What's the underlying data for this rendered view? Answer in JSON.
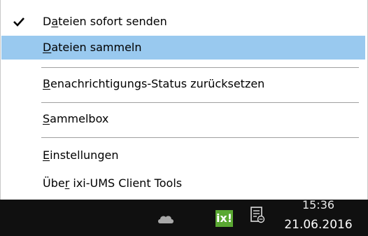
{
  "menu": {
    "items": [
      {
        "label": "Dateien sofort senden",
        "accel_index": 1,
        "checked": true,
        "selected": false
      },
      {
        "label": "Dateien sammeln",
        "accel_index": 0,
        "checked": false,
        "selected": true
      },
      {
        "label": "Benachrichtigungs-Status zurücksetzen",
        "accel_index": 0,
        "checked": false,
        "selected": false
      },
      {
        "label": "Sammelbox",
        "accel_index": 0,
        "checked": false,
        "selected": false
      },
      {
        "label": "Einstellungen",
        "accel_index": 0,
        "checked": false,
        "selected": false
      },
      {
        "label": "Über ixi-UMS Client Tools",
        "accel_index": 3,
        "checked": false,
        "selected": false
      }
    ]
  },
  "taskbar": {
    "tray_icons": [
      "cloud-icon",
      "ixi-ums-icon",
      "action-center-icon"
    ],
    "ixi_label": "ix!",
    "time": "15:36",
    "date": "21.06.2016"
  },
  "colors": {
    "highlight": "#99c9ef",
    "taskbar": "#101010",
    "ixi_green": "#5aa832"
  }
}
